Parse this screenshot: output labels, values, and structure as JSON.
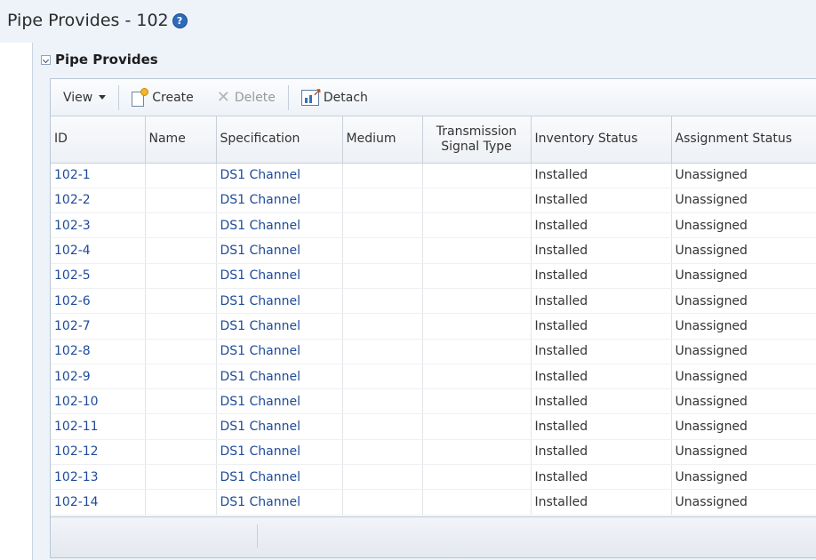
{
  "page": {
    "title": "Pipe Provides - 102"
  },
  "section": {
    "title": "Pipe Provides"
  },
  "toolbar": {
    "view_label": "View",
    "create_label": "Create",
    "delete_label": "Delete",
    "detach_label": "Detach"
  },
  "table": {
    "columns": [
      "ID",
      "Name",
      "Specification",
      "Medium",
      "Transmission Signal Type",
      "Inventory Status",
      "Assignment Status"
    ],
    "rows": [
      {
        "id": "102-1",
        "name": "",
        "spec": "DS1 Channel",
        "medium": "",
        "signal": "",
        "inventory": "Installed",
        "assignment": "Unassigned"
      },
      {
        "id": "102-2",
        "name": "",
        "spec": "DS1 Channel",
        "medium": "",
        "signal": "",
        "inventory": "Installed",
        "assignment": "Unassigned"
      },
      {
        "id": "102-3",
        "name": "",
        "spec": "DS1 Channel",
        "medium": "",
        "signal": "",
        "inventory": "Installed",
        "assignment": "Unassigned"
      },
      {
        "id": "102-4",
        "name": "",
        "spec": "DS1 Channel",
        "medium": "",
        "signal": "",
        "inventory": "Installed",
        "assignment": "Unassigned"
      },
      {
        "id": "102-5",
        "name": "",
        "spec": "DS1 Channel",
        "medium": "",
        "signal": "",
        "inventory": "Installed",
        "assignment": "Unassigned"
      },
      {
        "id": "102-6",
        "name": "",
        "spec": "DS1 Channel",
        "medium": "",
        "signal": "",
        "inventory": "Installed",
        "assignment": "Unassigned"
      },
      {
        "id": "102-7",
        "name": "",
        "spec": "DS1 Channel",
        "medium": "",
        "signal": "",
        "inventory": "Installed",
        "assignment": "Unassigned"
      },
      {
        "id": "102-8",
        "name": "",
        "spec": "DS1 Channel",
        "medium": "",
        "signal": "",
        "inventory": "Installed",
        "assignment": "Unassigned"
      },
      {
        "id": "102-9",
        "name": "",
        "spec": "DS1 Channel",
        "medium": "",
        "signal": "",
        "inventory": "Installed",
        "assignment": "Unassigned"
      },
      {
        "id": "102-10",
        "name": "",
        "spec": "DS1 Channel",
        "medium": "",
        "signal": "",
        "inventory": "Installed",
        "assignment": "Unassigned"
      },
      {
        "id": "102-11",
        "name": "",
        "spec": "DS1 Channel",
        "medium": "",
        "signal": "",
        "inventory": "Installed",
        "assignment": "Unassigned"
      },
      {
        "id": "102-12",
        "name": "",
        "spec": "DS1 Channel",
        "medium": "",
        "signal": "",
        "inventory": "Installed",
        "assignment": "Unassigned"
      },
      {
        "id": "102-13",
        "name": "",
        "spec": "DS1 Channel",
        "medium": "",
        "signal": "",
        "inventory": "Installed",
        "assignment": "Unassigned"
      },
      {
        "id": "102-14",
        "name": "",
        "spec": "DS1 Channel",
        "medium": "",
        "signal": "",
        "inventory": "Installed",
        "assignment": "Unassigned"
      }
    ]
  },
  "colors": {
    "link": "#1f4b9a",
    "panel_bg": "#eef3fa",
    "help_icon": "#2e6ab8"
  },
  "icons": [
    "help-icon",
    "collapse-icon",
    "chevron-down-icon",
    "create-icon",
    "delete-icon",
    "detach-icon"
  ]
}
